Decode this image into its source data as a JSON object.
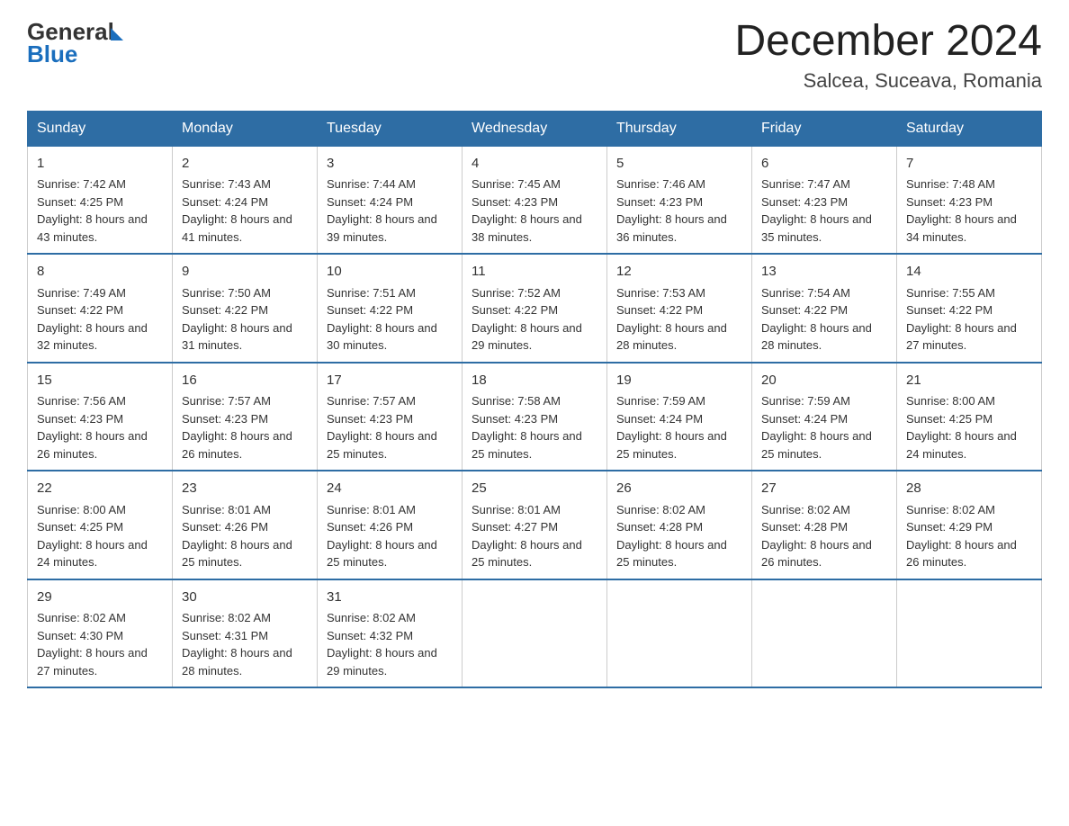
{
  "logo": {
    "general": "General",
    "blue": "Blue"
  },
  "title": "December 2024",
  "location": "Salcea, Suceava, Romania",
  "days_of_week": [
    "Sunday",
    "Monday",
    "Tuesday",
    "Wednesday",
    "Thursday",
    "Friday",
    "Saturday"
  ],
  "weeks": [
    [
      {
        "day": "1",
        "sunrise": "7:42 AM",
        "sunset": "4:25 PM",
        "daylight": "8 hours and 43 minutes."
      },
      {
        "day": "2",
        "sunrise": "7:43 AM",
        "sunset": "4:24 PM",
        "daylight": "8 hours and 41 minutes."
      },
      {
        "day": "3",
        "sunrise": "7:44 AM",
        "sunset": "4:24 PM",
        "daylight": "8 hours and 39 minutes."
      },
      {
        "day": "4",
        "sunrise": "7:45 AM",
        "sunset": "4:23 PM",
        "daylight": "8 hours and 38 minutes."
      },
      {
        "day": "5",
        "sunrise": "7:46 AM",
        "sunset": "4:23 PM",
        "daylight": "8 hours and 36 minutes."
      },
      {
        "day": "6",
        "sunrise": "7:47 AM",
        "sunset": "4:23 PM",
        "daylight": "8 hours and 35 minutes."
      },
      {
        "day": "7",
        "sunrise": "7:48 AM",
        "sunset": "4:23 PM",
        "daylight": "8 hours and 34 minutes."
      }
    ],
    [
      {
        "day": "8",
        "sunrise": "7:49 AM",
        "sunset": "4:22 PM",
        "daylight": "8 hours and 32 minutes."
      },
      {
        "day": "9",
        "sunrise": "7:50 AM",
        "sunset": "4:22 PM",
        "daylight": "8 hours and 31 minutes."
      },
      {
        "day": "10",
        "sunrise": "7:51 AM",
        "sunset": "4:22 PM",
        "daylight": "8 hours and 30 minutes."
      },
      {
        "day": "11",
        "sunrise": "7:52 AM",
        "sunset": "4:22 PM",
        "daylight": "8 hours and 29 minutes."
      },
      {
        "day": "12",
        "sunrise": "7:53 AM",
        "sunset": "4:22 PM",
        "daylight": "8 hours and 28 minutes."
      },
      {
        "day": "13",
        "sunrise": "7:54 AM",
        "sunset": "4:22 PM",
        "daylight": "8 hours and 28 minutes."
      },
      {
        "day": "14",
        "sunrise": "7:55 AM",
        "sunset": "4:22 PM",
        "daylight": "8 hours and 27 minutes."
      }
    ],
    [
      {
        "day": "15",
        "sunrise": "7:56 AM",
        "sunset": "4:23 PM",
        "daylight": "8 hours and 26 minutes."
      },
      {
        "day": "16",
        "sunrise": "7:57 AM",
        "sunset": "4:23 PM",
        "daylight": "8 hours and 26 minutes."
      },
      {
        "day": "17",
        "sunrise": "7:57 AM",
        "sunset": "4:23 PM",
        "daylight": "8 hours and 25 minutes."
      },
      {
        "day": "18",
        "sunrise": "7:58 AM",
        "sunset": "4:23 PM",
        "daylight": "8 hours and 25 minutes."
      },
      {
        "day": "19",
        "sunrise": "7:59 AM",
        "sunset": "4:24 PM",
        "daylight": "8 hours and 25 minutes."
      },
      {
        "day": "20",
        "sunrise": "7:59 AM",
        "sunset": "4:24 PM",
        "daylight": "8 hours and 25 minutes."
      },
      {
        "day": "21",
        "sunrise": "8:00 AM",
        "sunset": "4:25 PM",
        "daylight": "8 hours and 24 minutes."
      }
    ],
    [
      {
        "day": "22",
        "sunrise": "8:00 AM",
        "sunset": "4:25 PM",
        "daylight": "8 hours and 24 minutes."
      },
      {
        "day": "23",
        "sunrise": "8:01 AM",
        "sunset": "4:26 PM",
        "daylight": "8 hours and 25 minutes."
      },
      {
        "day": "24",
        "sunrise": "8:01 AM",
        "sunset": "4:26 PM",
        "daylight": "8 hours and 25 minutes."
      },
      {
        "day": "25",
        "sunrise": "8:01 AM",
        "sunset": "4:27 PM",
        "daylight": "8 hours and 25 minutes."
      },
      {
        "day": "26",
        "sunrise": "8:02 AM",
        "sunset": "4:28 PM",
        "daylight": "8 hours and 25 minutes."
      },
      {
        "day": "27",
        "sunrise": "8:02 AM",
        "sunset": "4:28 PM",
        "daylight": "8 hours and 26 minutes."
      },
      {
        "day": "28",
        "sunrise": "8:02 AM",
        "sunset": "4:29 PM",
        "daylight": "8 hours and 26 minutes."
      }
    ],
    [
      {
        "day": "29",
        "sunrise": "8:02 AM",
        "sunset": "4:30 PM",
        "daylight": "8 hours and 27 minutes."
      },
      {
        "day": "30",
        "sunrise": "8:02 AM",
        "sunset": "4:31 PM",
        "daylight": "8 hours and 28 minutes."
      },
      {
        "day": "31",
        "sunrise": "8:02 AM",
        "sunset": "4:32 PM",
        "daylight": "8 hours and 29 minutes."
      },
      null,
      null,
      null,
      null
    ]
  ]
}
